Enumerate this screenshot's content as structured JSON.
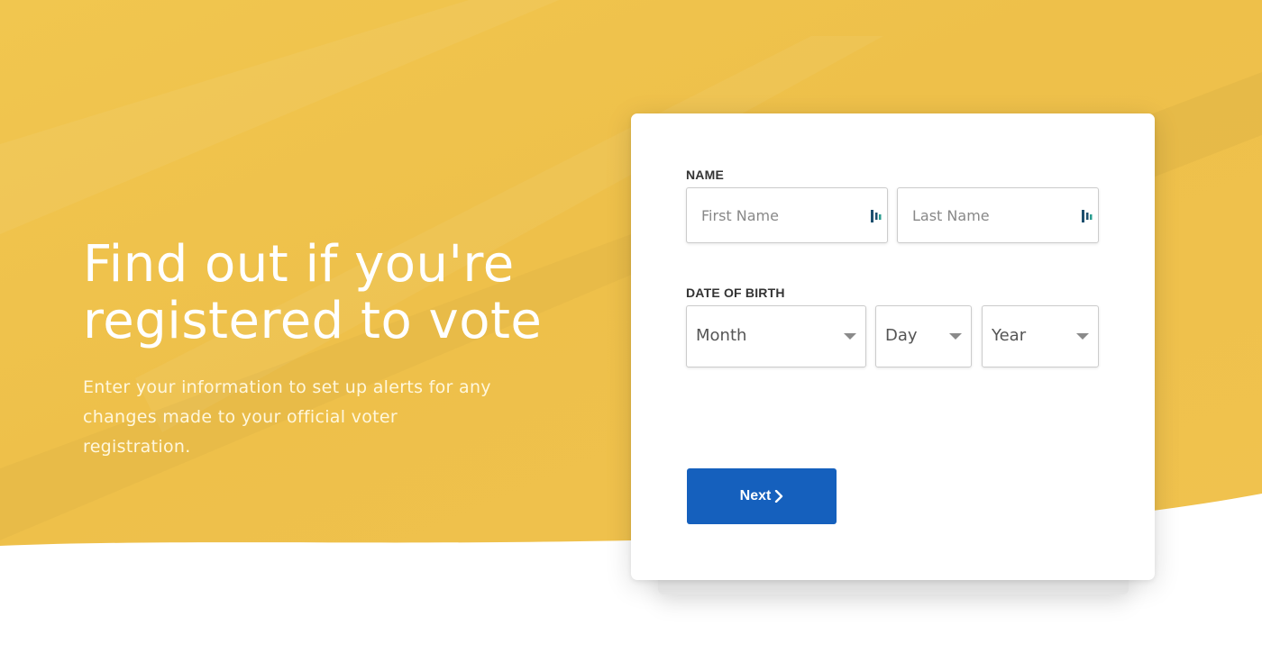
{
  "colors": {
    "hero_yellow": "#F0C24E",
    "button_blue": "#1560BD",
    "card_background": "#FFFFFF"
  },
  "hero": {
    "title_line1": "Find out if you're",
    "title_line2": "registered to vote",
    "subtitle": "Enter your information to set up alerts for any changes made to your official voter registration."
  },
  "form": {
    "name_label": "NAME",
    "first_name": {
      "value": "",
      "placeholder": "First Name",
      "autofill_icon": "contact-autofill-icon"
    },
    "last_name": {
      "value": "",
      "placeholder": "Last Name",
      "autofill_icon": "contact-autofill-icon"
    },
    "dob_label": "DATE OF BIRTH",
    "month": {
      "selected": "Month",
      "icon": "caret-down-icon"
    },
    "day": {
      "selected": "Day",
      "icon": "caret-down-icon"
    },
    "year": {
      "selected": "Year",
      "icon": "caret-down-icon"
    },
    "next_label": "Next",
    "next_icon": "chevron-right-icon"
  }
}
